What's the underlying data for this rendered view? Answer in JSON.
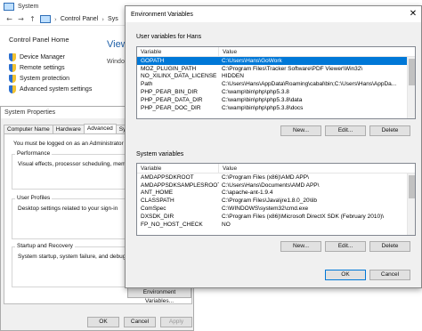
{
  "system_window": {
    "title": "System",
    "breadcrumb": [
      "Control Panel",
      "Sys"
    ],
    "home_link": "Control Panel Home",
    "links": [
      "Device Manager",
      "Remote settings",
      "System protection",
      "Advanced system settings"
    ],
    "view_text": "View",
    "windo_text": "Windo"
  },
  "system_properties": {
    "title": "System Properties",
    "tabs": [
      "Computer Name",
      "Hardware",
      "Advanced",
      "System"
    ],
    "active_tab": "Advanced",
    "admin_note": "You must be logged on as an Administrator to make m",
    "performance": {
      "label": "Performance",
      "text": "Visual effects, processor scheduling, memory usa"
    },
    "user_profiles": {
      "label": "User Profiles",
      "text": "Desktop settings related to your sign-in"
    },
    "startup_recovery": {
      "label": "Startup and Recovery",
      "text": "System startup, system failure, and debugging in"
    },
    "env_button": "Environment Variables...",
    "ok": "OK",
    "cancel": "Cancel",
    "apply": "Apply"
  },
  "env_vars": {
    "title": "Environment Variables",
    "close_glyph": "✕",
    "user_section_label": "User variables for Hans",
    "columns": [
      "Variable",
      "Value"
    ],
    "user_vars": [
      {
        "variable": "GOPATH",
        "value": "C:\\Users\\Hans\\GoWork",
        "selected": true
      },
      {
        "variable": "MOZ_PLUGIN_PATH",
        "value": "C:\\Program Files\\Tracker Software\\PDF Viewer\\Win32\\",
        "selected": false
      },
      {
        "variable": "NO_XILINX_DATA_LICENSE",
        "value": "HIDDEN",
        "selected": false
      },
      {
        "variable": "Path",
        "value": "C:\\Users\\Hans\\AppData\\Roaming\\cabal\\bin;C:\\Users\\Hans\\AppDa...",
        "selected": false
      },
      {
        "variable": "PHP_PEAR_BIN_DIR",
        "value": "C:\\wamp\\bin\\php\\php5.3.8",
        "selected": false
      },
      {
        "variable": "PHP_PEAR_DATA_DIR",
        "value": "C:\\wamp\\bin\\php\\php5.3.8\\data",
        "selected": false
      },
      {
        "variable": "PHP_PEAR_DOC_DIR",
        "value": "C:\\wamp\\bin\\php\\php5.3.8\\docs",
        "selected": false
      }
    ],
    "user_buttons": [
      "New...",
      "Edit...",
      "Delete"
    ],
    "system_section_label": "System variables",
    "system_vars": [
      {
        "variable": "AMDAPPSDKROOT",
        "value": "C:\\Program Files (x86)\\AMD APP\\"
      },
      {
        "variable": "AMDAPPSDKSAMPLESROOT",
        "value": "C:\\Users\\Hans\\Documents\\AMD APP\\"
      },
      {
        "variable": "ANT_HOME",
        "value": "C:\\apache-ant-1.9.4"
      },
      {
        "variable": "CLASSPATH",
        "value": "C:\\Program Files\\Java\\jre1.8.0_20\\lib"
      },
      {
        "variable": "ComSpec",
        "value": "C:\\WINDOWS\\system32\\cmd.exe"
      },
      {
        "variable": "DXSDK_DIR",
        "value": "C:\\Program Files (x86)\\Microsoft DirectX SDK (February 2010)\\"
      },
      {
        "variable": "FP_NO_HOST_CHECK",
        "value": "NO"
      }
    ],
    "system_buttons": [
      "New...",
      "Edit...",
      "Delete"
    ],
    "ok": "OK",
    "cancel": "Cancel"
  }
}
